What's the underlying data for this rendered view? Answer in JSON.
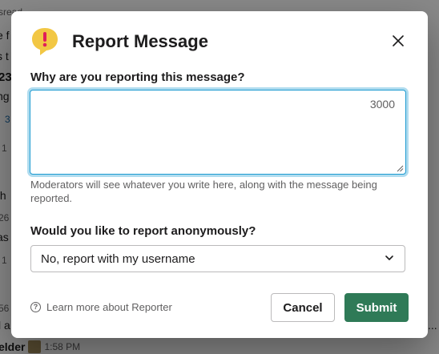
{
  "background": {
    "lines": [
      "sread",
      "e f",
      "s t",
      "23",
      "ng",
      "3",
      "1",
      "th",
      "26",
      "as",
      "1",
      "56",
      "l a"
    ],
    "bottom_name": "elder",
    "bottom_time": "1:58 PM",
    "bottom_ellipsis": "..."
  },
  "modal": {
    "title": "Report Message",
    "icon": "report-speech-bubble-icon",
    "close_icon": "close-icon",
    "question1": "Why are you reporting this message?",
    "char_limit": "3000",
    "textarea_value": "",
    "helper_text": "Moderators will see whatever you write here, along with the message being reported.",
    "question2": "Would you like to report anonymously?",
    "select_value": "No, report with my username",
    "learn_more": "Learn more about Reporter",
    "cancel_label": "Cancel",
    "submit_label": "Submit"
  },
  "colors": {
    "submit_bg": "#2f7a57",
    "focus_ring": "#1d9bd1",
    "icon_yellow": "#f2c744",
    "icon_red": "#e01e5a"
  }
}
